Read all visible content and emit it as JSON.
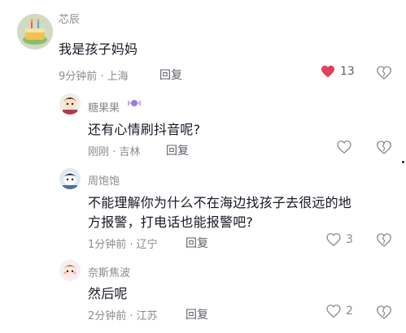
{
  "comments": [
    {
      "user": "芯辰",
      "text": "我是孩子妈妈",
      "meta": "9分钟前 · 上海",
      "reply_label": "回复",
      "like_count": "13",
      "liked": true,
      "avatar_icon": "cake-avatar-icon"
    },
    {
      "user": "糖果果",
      "user_badge_icon": "candy-icon",
      "text": "还有心情刷抖音呢?",
      "meta": "刚刚 · 吉林",
      "reply_label": "回复",
      "like_count": "",
      "avatar_icon": "cartoon-avatar-icon"
    },
    {
      "user": "周饱饱",
      "text_line1": "不能理解你为什么不在海边找孩子去很远的地",
      "text_line2": "方报警，打电话也能报警吧?",
      "meta": "1分钟前 · 辽宁",
      "reply_label": "回复",
      "like_count": "3",
      "avatar_icon": "cartoon-avatar-icon"
    },
    {
      "user": "奈斯焦波",
      "text": "然后呢",
      "meta": "2分钟前 · 江苏",
      "reply_label": "回复",
      "like_count": "2",
      "avatar_icon": "cartoon-avatar-icon"
    }
  ],
  "colors": {
    "liked_heart": "#e0425a",
    "muted_text": "#8a8b91",
    "primary_text": "#161823"
  }
}
